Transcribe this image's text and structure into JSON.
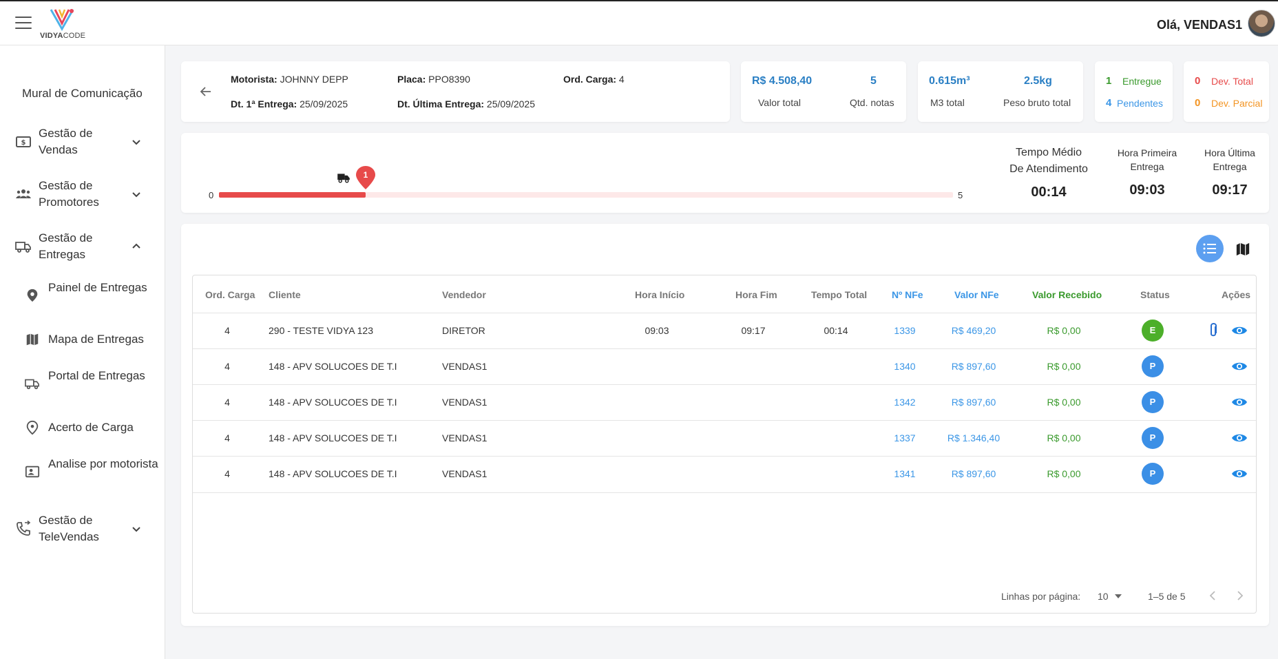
{
  "header": {
    "logo_text_bold": "VIDYA",
    "logo_text_light": "CODE",
    "greeting": "Olá, VENDAS1"
  },
  "sidebar": {
    "mural": "Mural de Comunicação",
    "items": [
      {
        "label": "Gestão de Vendas",
        "icon": "sales-icon"
      },
      {
        "label": "Gestão de Promotores",
        "icon": "people-icon"
      },
      {
        "label": "Gestão de Entregas",
        "icon": "truck-icon"
      },
      {
        "label": "Gestão de TeleVendas",
        "icon": "phone-icon"
      }
    ],
    "sub_items": [
      {
        "label": "Painel de Entregas",
        "icon": "pin-icon"
      },
      {
        "label": "Mapa de Entregas",
        "icon": "map-icon"
      },
      {
        "label": "Portal de Entregas",
        "icon": "truck-icon"
      },
      {
        "label": "Acerto de Carga",
        "icon": "location-icon"
      },
      {
        "label": "Analise por motorista",
        "icon": "id-card-icon"
      }
    ]
  },
  "info": {
    "motorista_label": "Motorista:",
    "motorista": "JOHNNY DEPP",
    "placa_label": "Placa:",
    "placa": "PPO8390",
    "ord_carga_label": "Ord. Carga:",
    "ord_carga": "4",
    "dt_primeira_label": "Dt. 1ª Entrega:",
    "dt_primeira": "25/09/2025",
    "dt_ultima_label": "Dt. Última Entrega:",
    "dt_ultima": "25/09/2025"
  },
  "stats": {
    "valor_total": "R$ 4.508,40",
    "valor_total_label": "Valor total",
    "qtd_notas": "5",
    "qtd_notas_label": "Qtd. notas",
    "m3_total": "0.615m³",
    "m3_total_label": "M3 total",
    "peso_bruto": "2.5kg",
    "peso_bruto_label": "Peso bruto total",
    "entregue_count": "1",
    "entregue_label": "Entregue",
    "pendentes_count": "4",
    "pendentes_label": "Pendentes",
    "dev_total_count": "0",
    "dev_total_label": "Dev. Total",
    "dev_parcial_count": "0",
    "dev_parcial_label": "Dev. Parcial"
  },
  "progress": {
    "min_label": "0",
    "max_label": "5",
    "current": 1,
    "max": 5,
    "badge": "1"
  },
  "times": {
    "medio_title_1": "Tempo Médio",
    "medio_title_2": "De Atendimento",
    "medio_value": "00:14",
    "primeira_title_1": "Hora Primeira",
    "primeira_title_2": "Entrega",
    "primeira_value": "09:03",
    "ultima_title_1": "Hora Última",
    "ultima_title_2": "Entrega",
    "ultima_value": "09:17"
  },
  "table": {
    "headers": {
      "ord": "Ord. Carga",
      "cliente": "Cliente",
      "vendedor": "Vendedor",
      "inicio": "Hora Início",
      "fim": "Hora Fim",
      "total": "Tempo Total",
      "nfe": "Nº NFe",
      "valor_nfe": "Valor NFe",
      "valor_recebido": "Valor Recebido",
      "status": "Status",
      "acoes": "Ações"
    },
    "rows": [
      {
        "ord": "4",
        "cliente": "290 - TESTE VIDYA 123",
        "vendedor": "DIRETOR",
        "inicio": "09:03",
        "fim": "09:17",
        "total": "00:14",
        "nfe": "1339",
        "valor_nfe": "R$ 469,20",
        "valor_recebido": "R$ 0,00",
        "status": "E",
        "status_color": "#4caf2a"
      },
      {
        "ord": "4",
        "cliente": "148 - APV SOLUCOES DE T.I",
        "vendedor": "VENDAS1",
        "inicio": "",
        "fim": "",
        "total": "",
        "nfe": "1340",
        "valor_nfe": "R$ 897,60",
        "valor_recebido": "R$ 0,00",
        "status": "P",
        "status_color": "#3b8fe6"
      },
      {
        "ord": "4",
        "cliente": "148 - APV SOLUCOES DE T.I",
        "vendedor": "VENDAS1",
        "inicio": "",
        "fim": "",
        "total": "",
        "nfe": "1342",
        "valor_nfe": "R$ 897,60",
        "valor_recebido": "R$ 0,00",
        "status": "P",
        "status_color": "#3b8fe6"
      },
      {
        "ord": "4",
        "cliente": "148 - APV SOLUCOES DE T.I",
        "vendedor": "VENDAS1",
        "inicio": "",
        "fim": "",
        "total": "",
        "nfe": "1337",
        "valor_nfe": "R$ 1.346,40",
        "valor_recebido": "R$ 0,00",
        "status": "P",
        "status_color": "#3b8fe6"
      },
      {
        "ord": "4",
        "cliente": "148 - APV SOLUCOES DE T.I",
        "vendedor": "VENDAS1",
        "inicio": "",
        "fim": "",
        "total": "",
        "nfe": "1341",
        "valor_nfe": "R$ 897,60",
        "valor_recebido": "R$ 0,00",
        "status": "P",
        "status_color": "#3b8fe6"
      }
    ],
    "footer": {
      "rows_per_page_label": "Linhas por página:",
      "rows_per_page": "10",
      "range": "1–5 de 5"
    }
  },
  "colors": {
    "accent_blue": "#3b96e6",
    "green": "#3a9a2d",
    "red": "#e74a4a",
    "orange": "#f39422"
  }
}
